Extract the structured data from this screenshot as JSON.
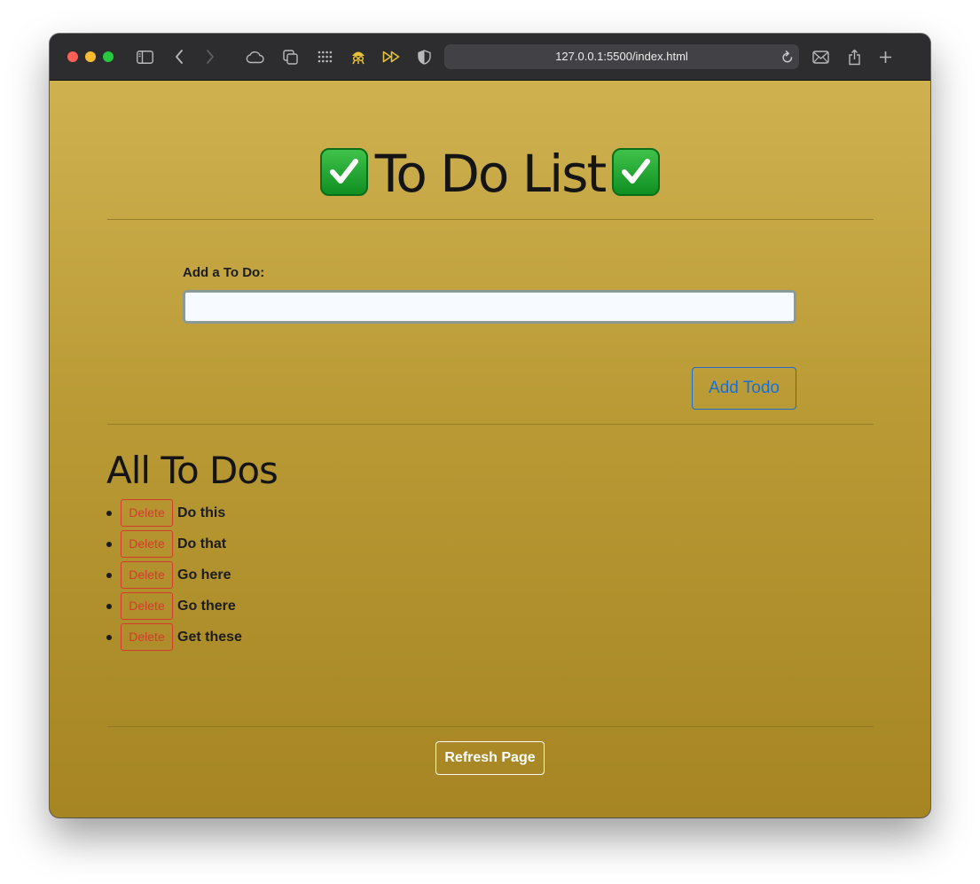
{
  "browser": {
    "url": "127.0.0.1:5500/index.html"
  },
  "page": {
    "title": "To Do List",
    "title_emoji": "✅",
    "form": {
      "label": "Add a To Do:",
      "input_value": "",
      "add_button": "Add Todo"
    },
    "list_title": "All To Dos",
    "todos": [
      {
        "delete_label": "Delete",
        "text": "Do this"
      },
      {
        "delete_label": "Delete",
        "text": "Do that"
      },
      {
        "delete_label": "Delete",
        "text": "Go here"
      },
      {
        "delete_label": "Delete",
        "text": "Go there"
      },
      {
        "delete_label": "Delete",
        "text": "Get these"
      }
    ],
    "refresh_button": "Refresh Page"
  },
  "colors": {
    "background_top": "#cfb150",
    "background_bottom": "#a68522",
    "primary": "#1a6fd6",
    "danger": "#d43a2e"
  }
}
